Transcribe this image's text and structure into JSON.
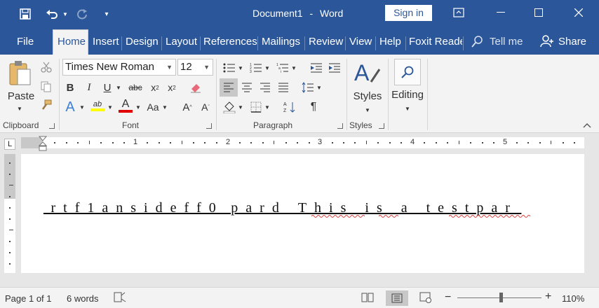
{
  "app": {
    "document_name": "Document1",
    "separator": "-",
    "app_name": "Word",
    "sign_in_label": "Sign in"
  },
  "tabs": [
    {
      "label": "File"
    },
    {
      "label": "Home",
      "active": true
    },
    {
      "label": "Insert"
    },
    {
      "label": "Design"
    },
    {
      "label": "Layout"
    },
    {
      "label": "References"
    },
    {
      "label": "Mailings"
    },
    {
      "label": "Review"
    },
    {
      "label": "View"
    },
    {
      "label": "Help"
    },
    {
      "label": "Foxit Reade"
    }
  ],
  "tell_me": {
    "placeholder": "Tell me"
  },
  "share_label": "Share",
  "clipboard": {
    "paste_label": "Paste",
    "group_label": "Clipboard"
  },
  "font": {
    "name": "Times New Roman",
    "size": "12",
    "group_label": "Font",
    "change_case_label": "Aa"
  },
  "paragraph": {
    "group_label": "Paragraph"
  },
  "styles": {
    "label": "Styles",
    "group_label": "Styles"
  },
  "editing": {
    "label": "Editing"
  },
  "ruler": {
    "numbers": [
      "1",
      "2",
      "3",
      "4",
      "5"
    ]
  },
  "document": {
    "text": "_r_t_f_1_a_n_s_i_d_e_f_f_0__p_a_r_d_ _T_h_i_s_ _i_s_ _a_ _t_e_s_t_p_a_r_ "
  },
  "status": {
    "page": "Page 1 of 1",
    "words": "6 words",
    "zoom": "110%",
    "zoom_level_percent": 110
  },
  "colors": {
    "brand": "#2b579a",
    "highlight": "#ffff00",
    "font_color": "#e00000"
  }
}
